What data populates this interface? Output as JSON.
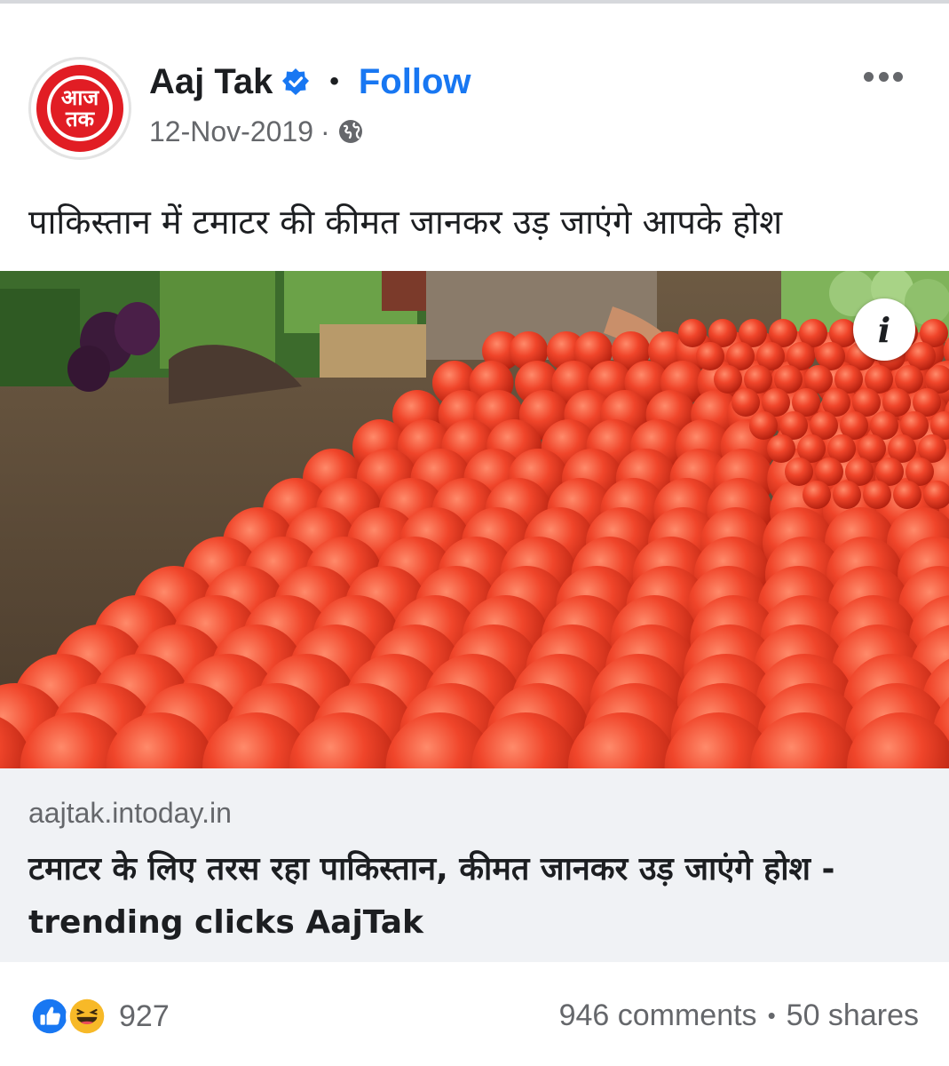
{
  "post": {
    "page_name": "Aaj Tak",
    "follow_label": "Follow",
    "separator": "•",
    "date": "12-Nov-2019",
    "meta_separator": "·",
    "avatar_text": "आज\nतक",
    "caption": "पाकिस्तान में टमाटर की कीमत जानकर उड़ जाएंगे आपके होश"
  },
  "link_preview": {
    "domain": "aajtak.intoday.in",
    "title": "टमाटर के लिए तरस रहा पाकिस्तान, कीमत जानकर उड़ जाएंगे होश - trending clicks AajTak"
  },
  "engagement": {
    "reaction_count": "927",
    "comments": "946 comments",
    "separator": "•",
    "shares": "50 shares"
  },
  "icons": {
    "verified": "verified-badge-icon",
    "globe": "globe-icon",
    "more": "more-options-icon",
    "info": "info-icon",
    "like": "like-reaction-icon",
    "haha": "haha-reaction-icon"
  },
  "colors": {
    "follow": "#1877f2",
    "brand_red": "#e11d24",
    "secondary_text": "#65676b",
    "link_box_bg": "#f0f2f5"
  },
  "info_label": "i"
}
